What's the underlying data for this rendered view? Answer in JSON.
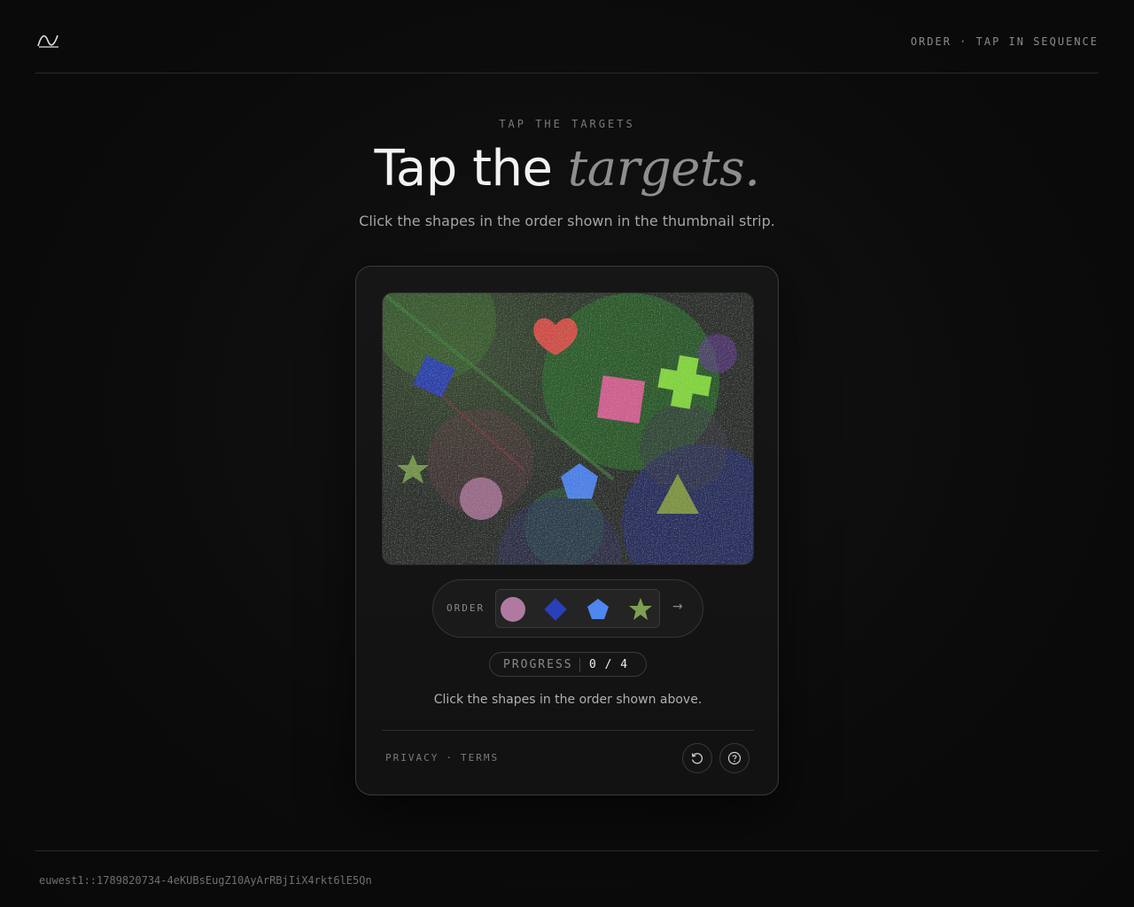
{
  "header": {
    "logo_icon": "wave-logo-icon",
    "mode_label": "ORDER · TAP IN SEQUENCE"
  },
  "hero": {
    "eyebrow": "TAP THE TARGETS",
    "title_main": "Tap the ",
    "title_accent": "targets.",
    "subtitle": "Click the shapes in the order shown in the thumbnail strip."
  },
  "challenge": {
    "canvas_shapes": [
      "heart",
      "diamond",
      "square",
      "cross",
      "star",
      "circle",
      "pentagon",
      "triangle",
      "circle"
    ],
    "order": {
      "label": "ORDER",
      "thumbnails": [
        {
          "shape": "circle",
          "color": "#b07aa0"
        },
        {
          "shape": "diamond",
          "color": "#2a40b8"
        },
        {
          "shape": "pentagon",
          "color": "#4f86f0"
        },
        {
          "shape": "star",
          "color": "#7da050"
        }
      ],
      "next_icon": "arrow-right-icon",
      "next_glyph": "→"
    },
    "progress": {
      "label": "PROGRESS",
      "value": "0 / 4",
      "current": 0,
      "total": 4
    },
    "instruction": "Click the shapes in the order shown above.",
    "footer": {
      "privacy": "PRIVACY",
      "separator": "·",
      "terms": "TERMS",
      "reload_icon": "reload-icon",
      "help_icon": "help-icon"
    }
  },
  "footer": {
    "session_id": "euwest1::1789820734-4eKUBsEugZ10AyArRBjIiX4rkt6lE5Qn"
  },
  "colors": {
    "background": "#0b0b0b",
    "card_border": "#3a3a3a",
    "heart": "#e0504a",
    "square": "#e0609a",
    "cross": "#8ee040",
    "diamond": "#2a40b8",
    "pentagon": "#4f86f0",
    "triangle": "#8aa040"
  }
}
